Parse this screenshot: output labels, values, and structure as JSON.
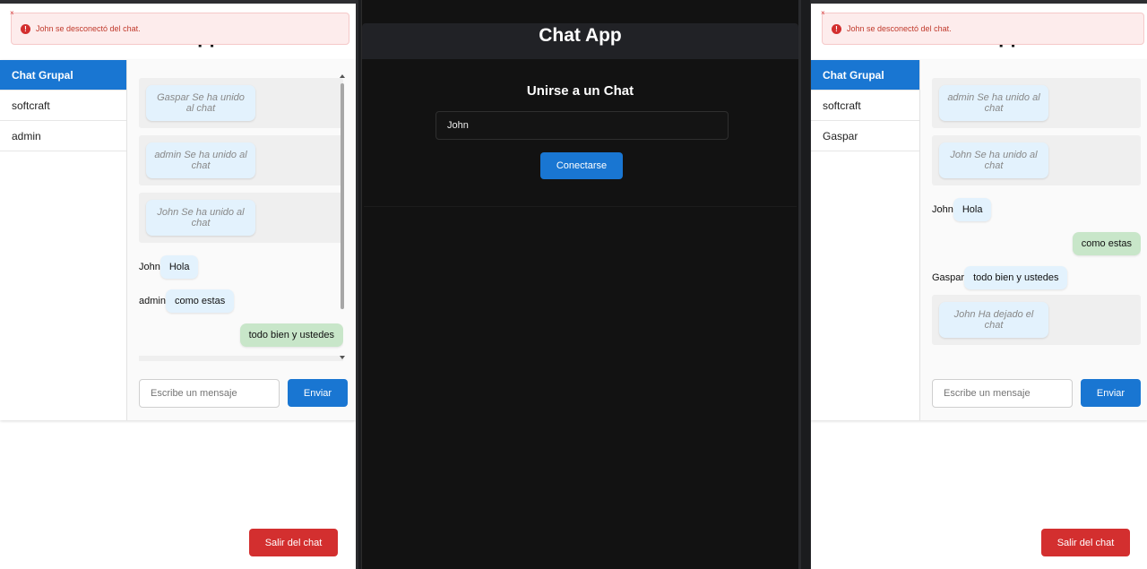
{
  "left": {
    "hidden_title": "Chat App",
    "toast": "John se desconectó del chat.",
    "toast_close": "×",
    "toast_icon": "!",
    "sidebar": [
      "Chat Grupal",
      "softcraft",
      "admin"
    ],
    "system_messages": [
      "Gaspar Se ha unido al chat",
      "admin Se ha unido al chat",
      "John Se ha unido al chat"
    ],
    "messages": [
      {
        "who": "John",
        "text": "Hola"
      },
      {
        "who": "admin",
        "text": "como estas"
      },
      {
        "who": "",
        "text": "todo bien y ustedes"
      }
    ],
    "input_placeholder": "Escribe un mensaje",
    "send": "Enviar",
    "leave": "Salir del chat"
  },
  "middle": {
    "title": "Chat App",
    "join_title": "Unirse a un Chat",
    "name_value": "John",
    "connect": "Conectarse"
  },
  "right": {
    "hidden_title": "Chat App",
    "toast": "John se desconectó del chat.",
    "toast_close": "×",
    "toast_icon": "!",
    "sidebar": [
      "Chat Grupal",
      "softcraft",
      "Gaspar"
    ],
    "system_messages": [
      "admin Se ha unido al chat",
      "John Se ha unido al chat"
    ],
    "messages": [
      {
        "who": "John",
        "text": "Hola"
      },
      {
        "who": "",
        "text": "como estas"
      },
      {
        "who": "Gaspar",
        "text": "todo bien y ustedes"
      }
    ],
    "system_after": "John Ha dejado el chat",
    "input_placeholder": "Escribe un mensaje",
    "send": "Enviar",
    "leave": "Salir del chat"
  },
  "colors": {
    "accent": "#1976d2",
    "danger": "#d32f2f",
    "mine_bubble": "#c8e6c9",
    "other_bubble": "#e3f2fd"
  }
}
